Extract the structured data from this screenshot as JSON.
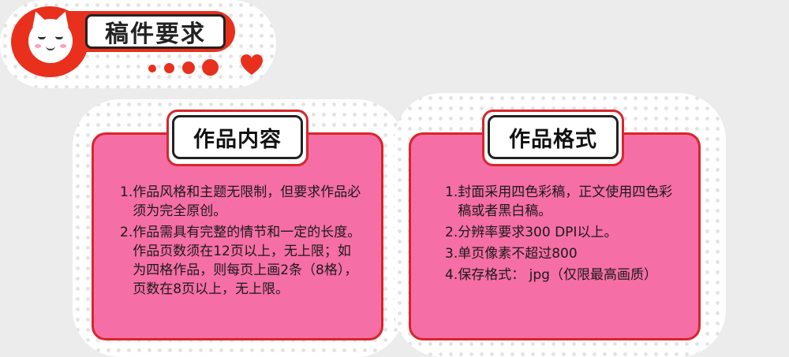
{
  "header": {
    "title": "稿件要求",
    "mascot_icon": "cat-face-icon",
    "accent_color": "#e8301c"
  },
  "cards": [
    {
      "title": "作品内容",
      "items": [
        {
          "num": "1.",
          "text": "作品风格和主题无限制，但要求作品必须为完全原创。"
        },
        {
          "num": "2.",
          "text": "作品需具有完整的情节和一定的长度。作品页数须在12页以上，无上限；如为四格作品，则每页上画2条（8格），页数在8页以上，无上限。"
        }
      ]
    },
    {
      "title": "作品格式",
      "items": [
        {
          "num": "1.",
          "text": "封面采用四色彩稿，正文使用四色彩稿或者黑白稿。"
        },
        {
          "num": "2.",
          "text": "分辨率要求300 DPI以上。"
        },
        {
          "num": "3.",
          "text": "单页像素不超过800"
        },
        {
          "num": "4.",
          "text": "保存格式： jpg（仅限最高画质）"
        }
      ]
    }
  ],
  "colors": {
    "card_fill": "#f66ea6",
    "card_border": "#d7262b",
    "background": "#ececec"
  }
}
